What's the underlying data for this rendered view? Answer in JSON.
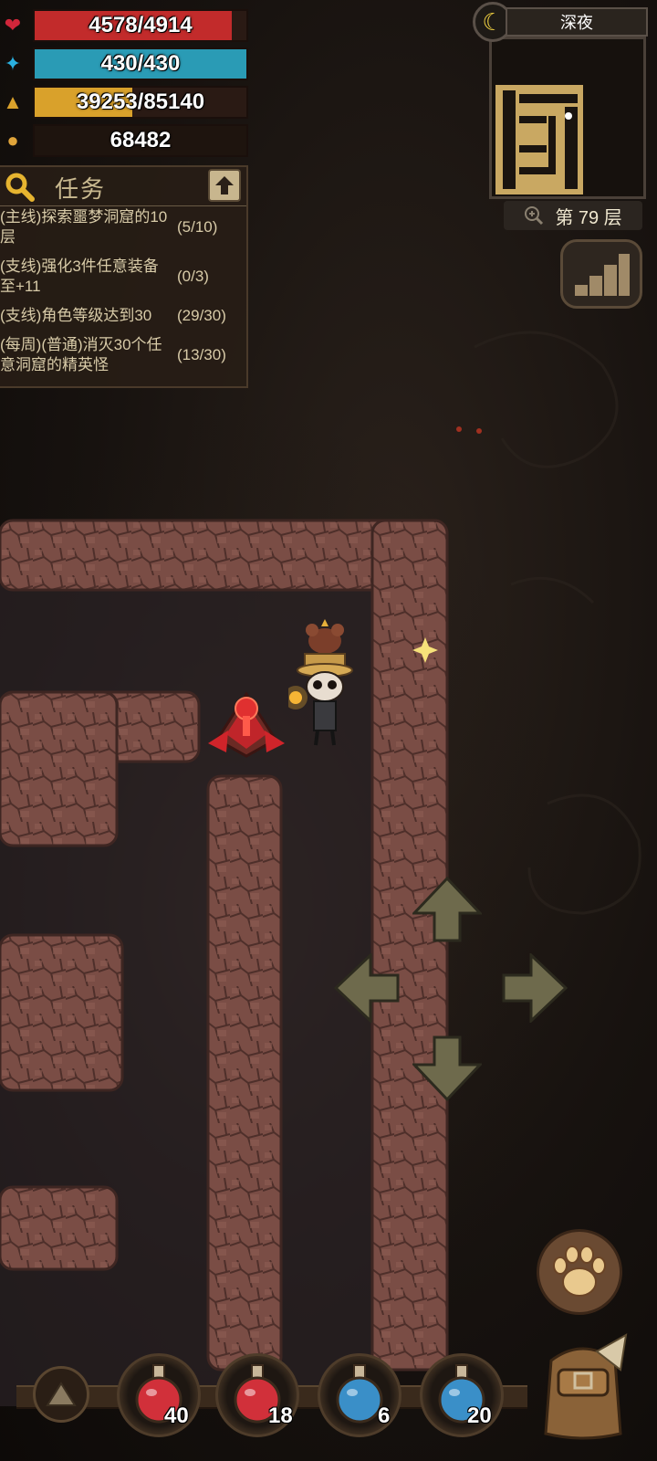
{
  "stats": {
    "hp": {
      "text": "4578/4914",
      "value": 4578,
      "max": 4914,
      "color": "#c22b2b",
      "icon": "heart-icon"
    },
    "mp": {
      "text": "430/430",
      "value": 430,
      "max": 430,
      "color": "#2a9bb5",
      "icon": "mana-spark-icon"
    },
    "xp": {
      "text": "39253/85140",
      "value": 39253,
      "max": 85140,
      "color": "#d9a12b",
      "icon": "level-triangle-icon"
    },
    "gold": {
      "text": "68482",
      "icon": "gold-pile-icon"
    }
  },
  "quests": {
    "title": "任务",
    "items": [
      {
        "text": "(主线)探索噩梦洞窟的10层",
        "progress": "(5/10)"
      },
      {
        "text": "(支线)强化3件任意装备至+11",
        "progress": "(0/3)"
      },
      {
        "text": "(支线)角色等级达到30",
        "progress": "(29/30)"
      },
      {
        "text": "(每周)(普通)消灭30个任意洞窟的精英怪",
        "progress": "(13/30)"
      }
    ]
  },
  "minimap": {
    "time_of_day": "深夜",
    "floor": "第 79 层"
  },
  "potions": [
    {
      "type": "health",
      "count": "40",
      "color": "#d1303a"
    },
    {
      "type": "health",
      "count": "18",
      "color": "#d1303a"
    },
    {
      "type": "mana",
      "count": "6",
      "color": "#3a8fc8"
    },
    {
      "type": "mana",
      "count": "20",
      "color": "#3a8fc8"
    }
  ]
}
